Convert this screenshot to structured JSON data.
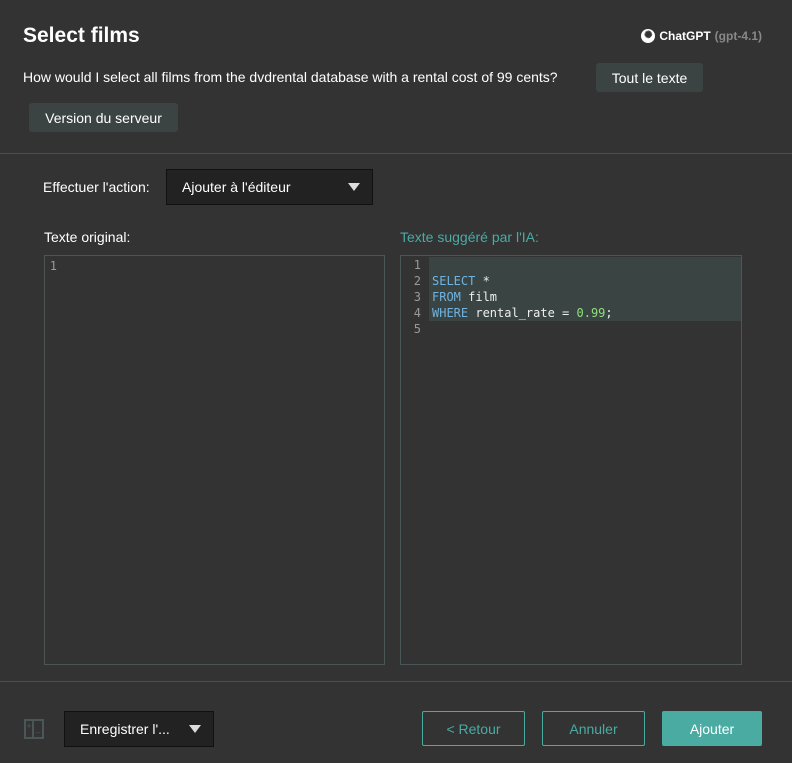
{
  "header": {
    "title": "Select films",
    "brand": "ChatGPT",
    "model": "(gpt-4.1)"
  },
  "question": "How would I select all films from the dvdrental database with a rental cost of 99 cents?",
  "chips": [
    "Tout le texte",
    "Version du serveur"
  ],
  "action": {
    "label": "Effectuer l'action:",
    "value": "Ajouter à l'éditeur"
  },
  "original": {
    "label": "Texte original:",
    "lines": [
      "1"
    ]
  },
  "suggested": {
    "label": "Texte suggéré par l'IA:",
    "line_numbers": [
      "1",
      "2",
      "3",
      "4",
      "5"
    ],
    "code": {
      "l2_kw": "SELECT",
      "l2_rest": " *",
      "l3_kw": "FROM",
      "l3_rest": " film",
      "l4_kw": "WHERE",
      "l4_mid": " rental_rate = ",
      "l4_num": "0.99",
      "l4_end": ";"
    }
  },
  "footer": {
    "save_select": "Enregistrer l'...",
    "back": "< Retour",
    "cancel": "Annuler",
    "add": "Ajouter"
  },
  "colors": {
    "accent": "#4aaba3",
    "background": "#333333"
  }
}
